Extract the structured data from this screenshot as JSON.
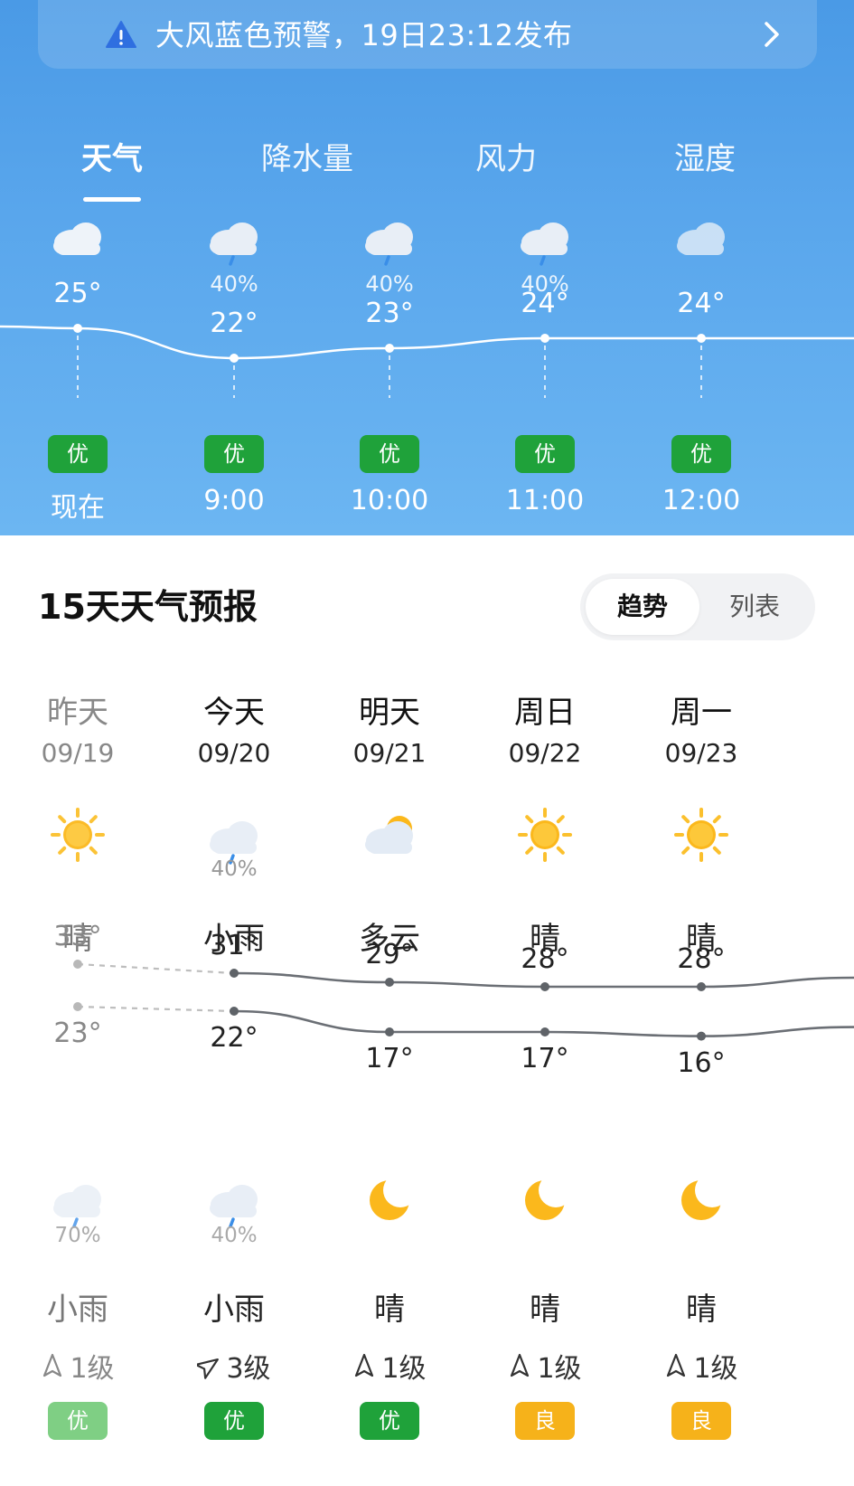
{
  "alert": {
    "text": "大风蓝色预警，19日23:12发布"
  },
  "tabs": [
    {
      "label": "天气",
      "active": true
    },
    {
      "label": "降水量",
      "active": false
    },
    {
      "label": "风力",
      "active": false
    },
    {
      "label": "湿度",
      "active": false
    }
  ],
  "hourly": [
    {
      "time": "现在",
      "temp": "25°",
      "temp_value": 25,
      "pop": "",
      "icon": "cloudy-icon",
      "aqi": "优"
    },
    {
      "time": "9:00",
      "temp": "22°",
      "temp_value": 22,
      "pop": "40%",
      "icon": "light-rain-icon",
      "aqi": "优"
    },
    {
      "time": "10:00",
      "temp": "23°",
      "temp_value": 23,
      "pop": "40%",
      "icon": "light-rain-icon",
      "aqi": "优"
    },
    {
      "time": "11:00",
      "temp": "24°",
      "temp_value": 24,
      "pop": "40%",
      "icon": "light-rain-icon",
      "aqi": "优"
    },
    {
      "time": "12:00",
      "temp": "24°",
      "temp_value": 24,
      "pop": "",
      "icon": "cloudy-faded-icon",
      "aqi": "优"
    }
  ],
  "forecast": {
    "title": "15天天气预报",
    "toggle": {
      "trend": "趋势",
      "list": "列表"
    },
    "days": [
      {
        "name": "昨天",
        "date": "09/19",
        "day_icon": "sunny-icon",
        "day_pop": "",
        "day_cond": "晴",
        "hi": "33°",
        "hi_value": 33,
        "lo": "23°",
        "lo_value": 23,
        "night_icon": "light-rain-icon",
        "night_pop": "70%",
        "night_cond": "小雨",
        "wind": "1级",
        "aqi": "优",
        "aqi_color": "#7fcf84",
        "past": true
      },
      {
        "name": "今天",
        "date": "09/20",
        "day_icon": "light-rain-icon",
        "day_pop": "40%",
        "day_cond": "小雨",
        "hi": "31°",
        "hi_value": 31,
        "lo": "22°",
        "lo_value": 22,
        "night_icon": "light-rain-icon",
        "night_pop": "40%",
        "night_cond": "小雨",
        "wind": "3级",
        "aqi": "优",
        "aqi_color": "#1fa23a",
        "past": false
      },
      {
        "name": "明天",
        "date": "09/21",
        "day_icon": "partly-cloudy-icon",
        "day_pop": "",
        "day_cond": "多云",
        "hi": "29°",
        "hi_value": 29,
        "lo": "17°",
        "lo_value": 17,
        "night_icon": "moon-icon",
        "night_pop": "",
        "night_cond": "晴",
        "wind": "1级",
        "aqi": "优",
        "aqi_color": "#1fa23a",
        "past": false
      },
      {
        "name": "周日",
        "date": "09/22",
        "day_icon": "sunny-icon",
        "day_pop": "",
        "day_cond": "晴",
        "hi": "28°",
        "hi_value": 28,
        "lo": "17°",
        "lo_value": 17,
        "night_icon": "moon-icon",
        "night_pop": "",
        "night_cond": "晴",
        "wind": "1级",
        "aqi": "良",
        "aqi_color": "#f6b21a",
        "past": false
      },
      {
        "name": "周一",
        "date": "09/23",
        "day_icon": "sunny-icon",
        "day_pop": "",
        "day_cond": "晴",
        "hi": "28°",
        "hi_value": 28,
        "lo": "16°",
        "lo_value": 16,
        "night_icon": "moon-icon",
        "night_pop": "",
        "night_cond": "晴",
        "wind": "1级",
        "aqi": "良",
        "aqi_color": "#f6b21a",
        "past": false
      }
    ]
  }
}
